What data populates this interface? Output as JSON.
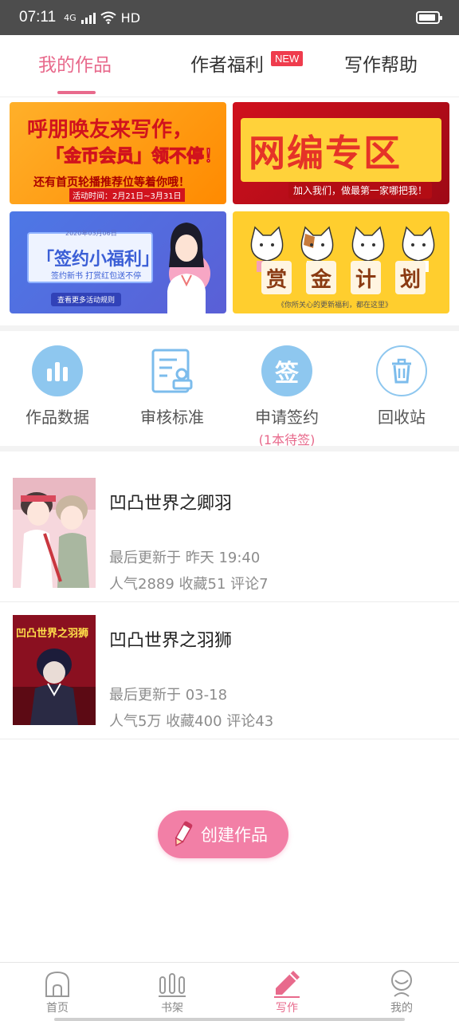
{
  "status_bar": {
    "time": "07:11",
    "network": "4G",
    "hd": "HD",
    "battery_level": 0.75
  },
  "top_tabs": [
    {
      "label": "我的作品",
      "active": true
    },
    {
      "label": "作者福利",
      "badge": "NEW"
    },
    {
      "label": "写作帮助"
    }
  ],
  "banners": {
    "b1": {
      "head": "呼朋唤友来写作，",
      "mid": "「金币会员」领不停！",
      "sub": "还有首页轮播推荐位等着你哦！",
      "date": "活动时间：2月21日~3月31日"
    },
    "b2": {
      "head": "网编专区",
      "sub": "加入我们，做最第一家哪把我！"
    },
    "b3": {
      "date": "2020年03月06日",
      "head": "「签约小福利」",
      "sub": "签约新书  打赏红包送不停",
      "button": "查看更多活动规则"
    },
    "b4": {
      "chars": [
        "赏",
        "金",
        "计",
        "划"
      ],
      "sub": "《你所关心的更新福利，都在这里》"
    }
  },
  "actions": [
    {
      "label": "作品数据",
      "icon": "bar-chart-icon"
    },
    {
      "label": "审核标准",
      "icon": "document-stamp-icon"
    },
    {
      "label": "申请签约",
      "sublabel": "(1本待签)",
      "icon": "sign-icon",
      "icon_text": "签"
    },
    {
      "label": "回收站",
      "icon": "trash-icon"
    }
  ],
  "works": [
    {
      "title": "凹凸世界之卿羽",
      "updated": "最后更新于 昨天 19:40",
      "stats": "人气2889 收藏51 评论7"
    },
    {
      "title": "凹凸世界之羽狮",
      "updated": "最后更新于 03-18",
      "stats": "人气5万 收藏400 评论43",
      "cover_text": "凹凸世界之羽狮"
    }
  ],
  "create_button": {
    "label": "创建作品"
  },
  "bottom_nav": [
    {
      "label": "首页",
      "icon": "home-icon"
    },
    {
      "label": "书架",
      "icon": "bookshelf-icon"
    },
    {
      "label": "写作",
      "icon": "pen-icon",
      "active": true
    },
    {
      "label": "我的",
      "icon": "profile-icon"
    }
  ],
  "colors": {
    "accent": "#e86a8c",
    "icon_blue": "#7cbcec",
    "status_bar": "#4d4d4d"
  }
}
